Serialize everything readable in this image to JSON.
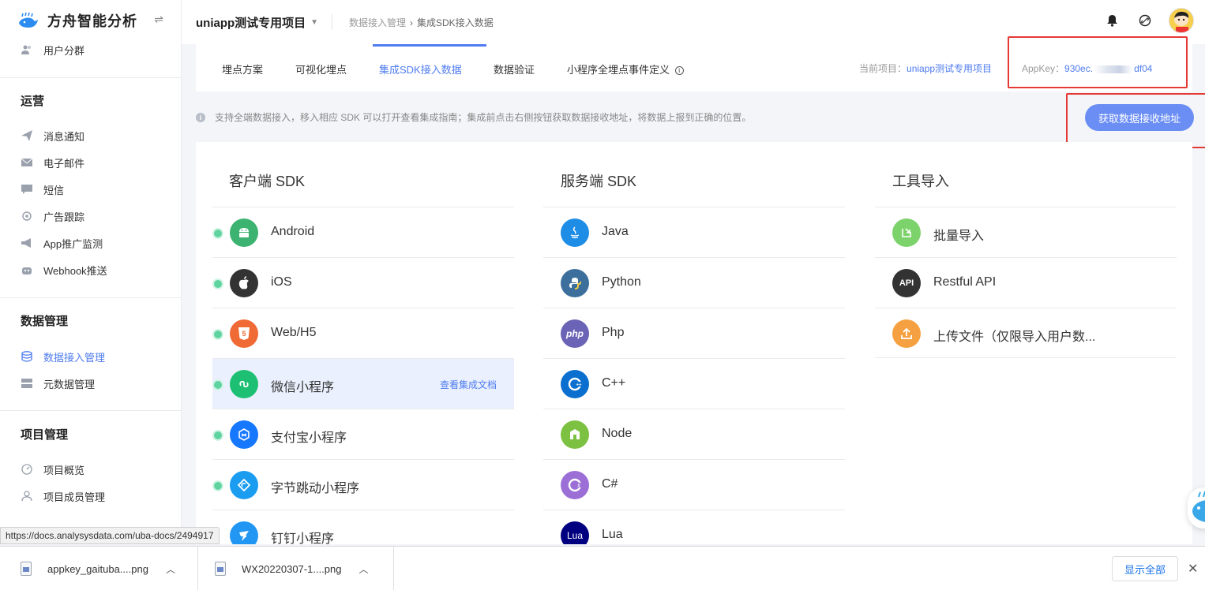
{
  "app": {
    "name": "方舟智能分析"
  },
  "sidebar": {
    "top_item": {
      "label": "用户分群"
    },
    "sections": [
      {
        "title": "运营",
        "items": [
          {
            "label": "消息通知",
            "icon": "send-icon"
          },
          {
            "label": "电子邮件",
            "icon": "mail-icon"
          },
          {
            "label": "短信",
            "icon": "sms-icon"
          },
          {
            "label": "广告跟踪",
            "icon": "target-icon"
          },
          {
            "label": "App推广监测",
            "icon": "megaphone-icon"
          },
          {
            "label": "Webhook推送",
            "icon": "robot-icon"
          }
        ]
      },
      {
        "title": "数据管理",
        "items": [
          {
            "label": "数据接入管理",
            "icon": "database-icon",
            "active": true
          },
          {
            "label": "元数据管理",
            "icon": "server-icon"
          }
        ]
      },
      {
        "title": "项目管理",
        "items": [
          {
            "label": "项目概览",
            "icon": "dashboard-icon"
          },
          {
            "label": "项目成员管理",
            "icon": "user-icon"
          }
        ]
      }
    ]
  },
  "topbar": {
    "project": "uniapp测试专用项目",
    "breadcrumb": [
      "数据接入管理",
      "集成SDK接入数据"
    ]
  },
  "tabs": [
    {
      "label": "埋点方案"
    },
    {
      "label": "可视化埋点"
    },
    {
      "label": "集成SDK接入数据",
      "active": true
    },
    {
      "label": "数据验证"
    },
    {
      "label": "小程序全埋点事件定义"
    }
  ],
  "current_project": {
    "label": "当前项目：",
    "value": "uniapp测试专用项目"
  },
  "appkey": {
    "label": "AppKey：",
    "prefix": "930ec.",
    "suffix": "df04"
  },
  "notice": "支持全端数据接入，移入相应 SDK 可以打开查看集成指南；集成前点击右侧按钮获取数据接收地址，将数据上报到正确的位置。",
  "get_address_button": "获取数据接收地址",
  "columns": [
    {
      "title": "客户端 SDK",
      "items": [
        {
          "label": "Android",
          "icon": "android-icon",
          "color": "#3cb371",
          "status": true
        },
        {
          "label": "iOS",
          "icon": "apple-icon",
          "color": "#333333",
          "status": true
        },
        {
          "label": "Web/H5",
          "icon": "html5-icon",
          "color": "#f06a35",
          "status": true
        },
        {
          "label": "微信小程序",
          "icon": "wechat-miniprogram-icon",
          "color": "#1dbf73",
          "status": true,
          "hover_link": "查看集成文档"
        },
        {
          "label": "支付宝小程序",
          "icon": "alipay-miniprogram-icon",
          "color": "#1677ff",
          "status": true
        },
        {
          "label": "字节跳动小程序",
          "icon": "bytedance-miniprogram-icon",
          "color": "#1a9cf0",
          "status": true
        },
        {
          "label": "钉钉小程序",
          "icon": "dingtalk-icon",
          "color": "#2196f3",
          "status": false
        }
      ]
    },
    {
      "title": "服务端 SDK",
      "items": [
        {
          "label": "Java",
          "icon": "java-icon",
          "color": "#1e8de6"
        },
        {
          "label": "Python",
          "icon": "python-icon",
          "color": "#3d6f9c"
        },
        {
          "label": "Php",
          "icon": "php-icon",
          "color": "#6b63b5"
        },
        {
          "label": "C++",
          "icon": "cpp-icon",
          "color": "#0a6fcf"
        },
        {
          "label": "Node",
          "icon": "node-icon",
          "color": "#7cc142"
        },
        {
          "label": "C#",
          "icon": "csharp-icon",
          "color": "#9b6fd6"
        },
        {
          "label": "Lua",
          "icon": "lua-icon",
          "color": "#000080"
        }
      ]
    },
    {
      "title": "工具导入",
      "items": [
        {
          "label": "批量导入",
          "icon": "batch-import-icon",
          "color": "#7dd36b"
        },
        {
          "label": "Restful API",
          "icon": "api-icon",
          "color": "#333333"
        },
        {
          "label": "上传文件（仅限导入用户数...",
          "icon": "upload-icon",
          "color": "#f5a142"
        }
      ]
    }
  ],
  "status_url": "https://docs.analysysdata.com/uba-docs/2494917",
  "downloads": [
    {
      "name": "appkey_gaituba....png"
    },
    {
      "name": "WX20220307-1....png"
    }
  ],
  "show_all": "显示全部"
}
